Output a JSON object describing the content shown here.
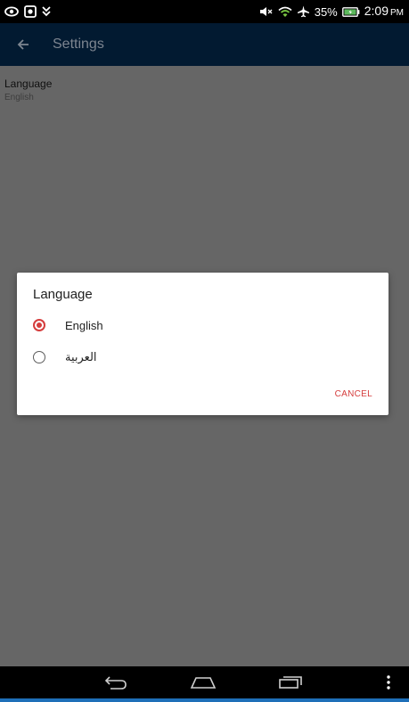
{
  "status_bar": {
    "left_icons": [
      "eye-icon",
      "screen-record-icon",
      "download-notification-icon"
    ],
    "right_icons": [
      "mute-icon",
      "wifi-icon",
      "airplane-icon",
      "battery-icon"
    ],
    "battery_percent": "35%",
    "time": "2:09",
    "ampm": "PM"
  },
  "app_bar": {
    "back_icon": "back-arrow-icon",
    "title": "Settings"
  },
  "preference": {
    "title": "Language",
    "summary": "English"
  },
  "dialog": {
    "title": "Language",
    "options": [
      {
        "label": "English",
        "selected": true
      },
      {
        "label": "العربية",
        "selected": false
      }
    ],
    "cancel_label": "CANCEL",
    "accent_color": "#d53d3d"
  },
  "nav_bar": {
    "buttons": [
      "back-icon",
      "home-icon",
      "recent-apps-icon",
      "overflow-menu-icon"
    ]
  },
  "colors": {
    "app_bar_dimmed": "#021a31",
    "scrim_background": "#666666",
    "accent": "#d53d3d"
  }
}
